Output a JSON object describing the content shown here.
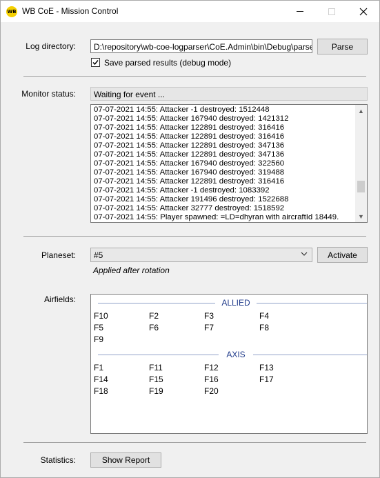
{
  "window": {
    "icon_text": "WB",
    "title": "WB CoE - Mission Control"
  },
  "log_directory": {
    "label": "Log directory:",
    "value": "D:\\repository\\wb-coe-logparser\\CoE.Admin\\bin\\Debug\\parsed",
    "parse_button": "Parse",
    "save_checkbox_label": "Save parsed results (debug mode)",
    "save_checked": true
  },
  "monitor": {
    "label": "Monitor status:",
    "status": "Waiting for event ...",
    "log_lines": [
      "07-07-2021 14:55: Attacker -1 destroyed: 1512448",
      "07-07-2021 14:55: Attacker 167940 destroyed: 1421312",
      "07-07-2021 14:55: Attacker 122891 destroyed: 316416",
      "07-07-2021 14:55: Attacker 122891 destroyed: 316416",
      "07-07-2021 14:55: Attacker 122891 destroyed: 347136",
      "07-07-2021 14:55: Attacker 122891 destroyed: 347136",
      "07-07-2021 14:55: Attacker 167940 destroyed: 322560",
      "07-07-2021 14:55: Attacker 167940 destroyed: 319488",
      "07-07-2021 14:55: Attacker 122891 destroyed: 316416",
      "07-07-2021 14:55: Attacker -1 destroyed: 1083392",
      "07-07-2021 14:55: Attacker 191496 destroyed: 1522688",
      "07-07-2021 14:55: Attacker 32777 destroyed: 1518592",
      "07-07-2021 14:55: Player spawned: =LD=dhyran with aircraftId 18449."
    ]
  },
  "planeset": {
    "label": "Planeset:",
    "selected": "#5",
    "activate_button": "Activate",
    "note": "Applied after rotation"
  },
  "airfields": {
    "label": "Airfields:",
    "allied_title": "ALLIED",
    "allied": [
      "F10",
      "F2",
      "F3",
      "F4",
      "F5",
      "F6",
      "F7",
      "F8",
      "F9"
    ],
    "axis_title": "AXIS",
    "axis": [
      "F1",
      "F11",
      "F12",
      "F13",
      "F14",
      "F15",
      "F16",
      "F17",
      "F18",
      "F19",
      "F20"
    ]
  },
  "statistics": {
    "label": "Statistics:",
    "button": "Show Report"
  },
  "colors": {
    "group_header": "#1f3a8a",
    "logo_yellow": "#f5d000"
  }
}
